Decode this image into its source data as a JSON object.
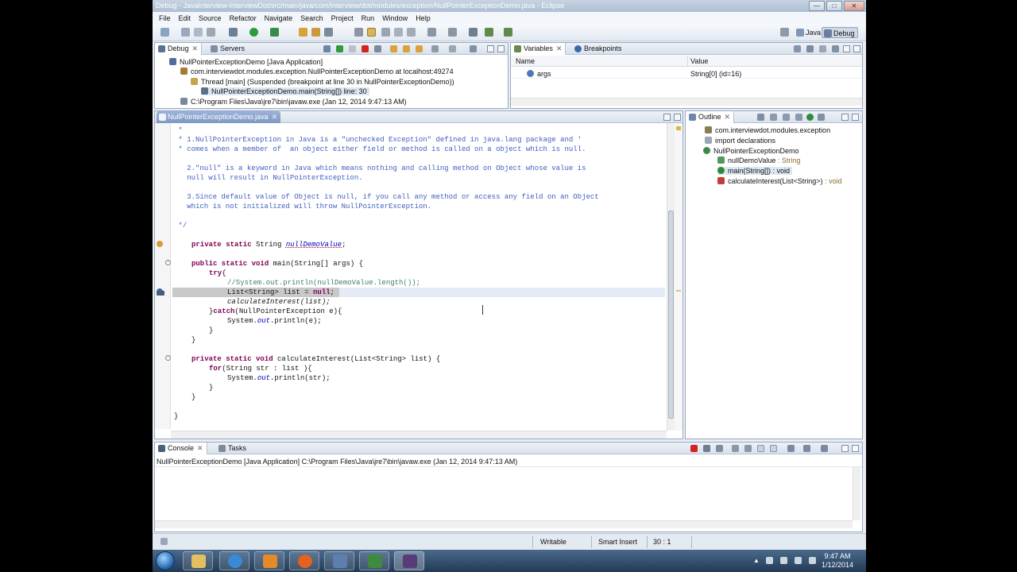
{
  "window": {
    "title": "Debug - JavaInterview-InterviewDot/src/main/java/com/interview/dot/modules/exception/NullPointerExceptionDemo.java - Eclipse",
    "buttons": {
      "minimize": "—",
      "maximize": "□",
      "close": "✕"
    }
  },
  "menu": [
    "File",
    "Edit",
    "Source",
    "Refactor",
    "Navigate",
    "Search",
    "Project",
    "Run",
    "Window",
    "Help"
  ],
  "perspectives": [
    {
      "label": "Java",
      "active": false
    },
    {
      "label": "Debug",
      "active": true
    }
  ],
  "debug_view": {
    "tabs": [
      "Debug",
      "Servers"
    ],
    "tree": [
      "NullPointerExceptionDemo [Java Application]",
      "com.interviewdot.modules.exception.NullPointerExceptionDemo at localhost:49274",
      "Thread [main] (Suspended (breakpoint at line 30 in NullPointerExceptionDemo))",
      "NullPointerExceptionDemo.main(String[]) line: 30",
      "C:\\Program Files\\Java\\jre7\\bin\\javaw.exe (Jan 12, 2014 9:47:13 AM)"
    ]
  },
  "variables_view": {
    "tabs": [
      "Variables",
      "Breakpoints"
    ],
    "columns": [
      "Name",
      "Value"
    ],
    "rows": [
      {
        "name": "args",
        "value": "String[0]  (id=16)"
      }
    ]
  },
  "editor": {
    "tab": "NullPointerExceptionDemo.java",
    "lines": {
      "l0": " *",
      "l1": " * 1.NullPointerException in Java is a \"unchecked Exception\" defined in java.lang package and '",
      "l2": " * comes when a member of  an object either field or method is called on a object which is null.",
      "l3": "   2.\"null\" is a keyword in Java which means nothing and calling method on Object whose value is",
      "l4": "   null will result in NullPointerException.",
      "l5": "   3.Since default value of Object is null, if you call any method or access any field on an Object",
      "l6": "   which is not initialized will throw NullPointerException.",
      "l7": " */",
      "l8a": "private static",
      "l8b": " String ",
      "l8c": "nullDemoValue",
      "l8d": ";",
      "l9a": "public static void",
      "l9b": " main(String[] args) {",
      "l10a": "try",
      "l10b": "{",
      "l11": "//System.out.println(nullDemoValue.length());",
      "l12a": "List<String> list = ",
      "l12b": "null",
      "l12c": ";",
      "l13": "calculateInterest(list);",
      "l14a": "}",
      "l14b": "catch",
      "l14c": "(NullPointerException e){",
      "l15a": "System.",
      "l15b": "out",
      "l15c": ".println(e);",
      "l16": "}",
      "l17": "}",
      "l18a": "private static void",
      "l18b": " calculateInterest(List<String> list) {",
      "l19a": "for",
      "l19b": "(String str : list ){",
      "l20a": "System.",
      "l20b": "out",
      "l20c": ".println(str);",
      "l21": "}",
      "l22": "}",
      "l23": "}"
    }
  },
  "outline_view": {
    "tab": "Outline",
    "items": [
      "com.interviewdot.modules.exception",
      "import declarations",
      "NullPointerExceptionDemo",
      "nullDemoValue",
      " : String",
      "main(String[])",
      " : void",
      "calculateInterest(List<String>)",
      " : void"
    ]
  },
  "console_view": {
    "tabs": [
      "Console",
      "Tasks"
    ],
    "header": "NullPointerExceptionDemo [Java Application] C:\\Program Files\\Java\\jre7\\bin\\javaw.exe (Jan 12, 2014 9:47:13 AM)"
  },
  "status_bar": {
    "writable": "Writable",
    "insert_mode": "Smart Insert",
    "position": "30 : 1"
  },
  "taskbar": {
    "time": "9:47 AM",
    "date": "1/12/2014"
  },
  "colors": {
    "comment": "#3f5fbf",
    "keyword": "#7f0055",
    "field": "#0000c0",
    "debug_line": "#c8c8c8"
  }
}
